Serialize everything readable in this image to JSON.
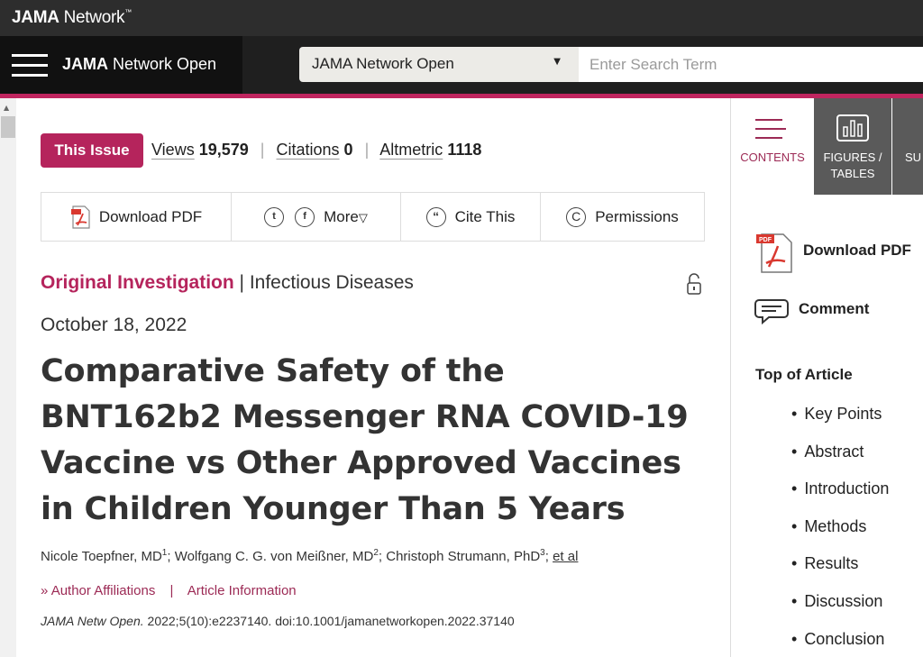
{
  "network": {
    "brand_bold": "JAMA",
    "brand_rest": " Network",
    "brand_tm": "™"
  },
  "header": {
    "journal_bold": "JAMA",
    "journal_rest": " Network Open",
    "search_select": "JAMA Network Open",
    "search_placeholder": "Enter Search Term"
  },
  "article_meta": {
    "issue_badge": "This Issue",
    "views_label": "Views",
    "views_value": "19,579",
    "citations_label": "Citations",
    "citations_value": "0",
    "altmetric_label": "Altmetric",
    "altmetric_value": "1118"
  },
  "toolbar": {
    "download_pdf": "Download PDF",
    "more": "More",
    "cite_this": "Cite This",
    "permissions": "Permissions"
  },
  "article": {
    "category": "Original Investigation",
    "category_sep": " | ",
    "subcategory": "Infectious Diseases",
    "date": "October 18, 2022",
    "title": "Comparative Safety of the BNT162b2 Messenger RNA COVID-19 Vaccine vs Other Approved Vaccines in Children Younger Than 5 Years",
    "authors": [
      {
        "name": "Nicole Toepfner, MD",
        "sup": "1"
      },
      {
        "name": "Wolfgang C. G. von Meißner, MD",
        "sup": "2"
      },
      {
        "name": "Christoph Strumann, PhD",
        "sup": "3"
      }
    ],
    "et_al": "et al",
    "author_affiliations": "Author Affiliations",
    "article_information": "Article Information",
    "citation_journal": "JAMA Netw Open.",
    "citation_rest": " 2022;5(10):e2237140. doi:10.1001/jamanetworkopen.2022.37140"
  },
  "sidebar": {
    "tabs": [
      {
        "label": "CONTENTS"
      },
      {
        "label": "FIGURES / TABLES"
      },
      {
        "label": "SU"
      }
    ],
    "download_pdf": "Download PDF",
    "comment": "Comment",
    "top_of_article": "Top of Article",
    "toc": [
      "Key Points",
      "Abstract",
      "Introduction",
      "Methods",
      "Results",
      "Discussion",
      "Conclusion"
    ]
  },
  "colors": {
    "accent": "#b5245c",
    "pink_rule": "#c0255f",
    "header_dark": "#1f1f1f"
  }
}
